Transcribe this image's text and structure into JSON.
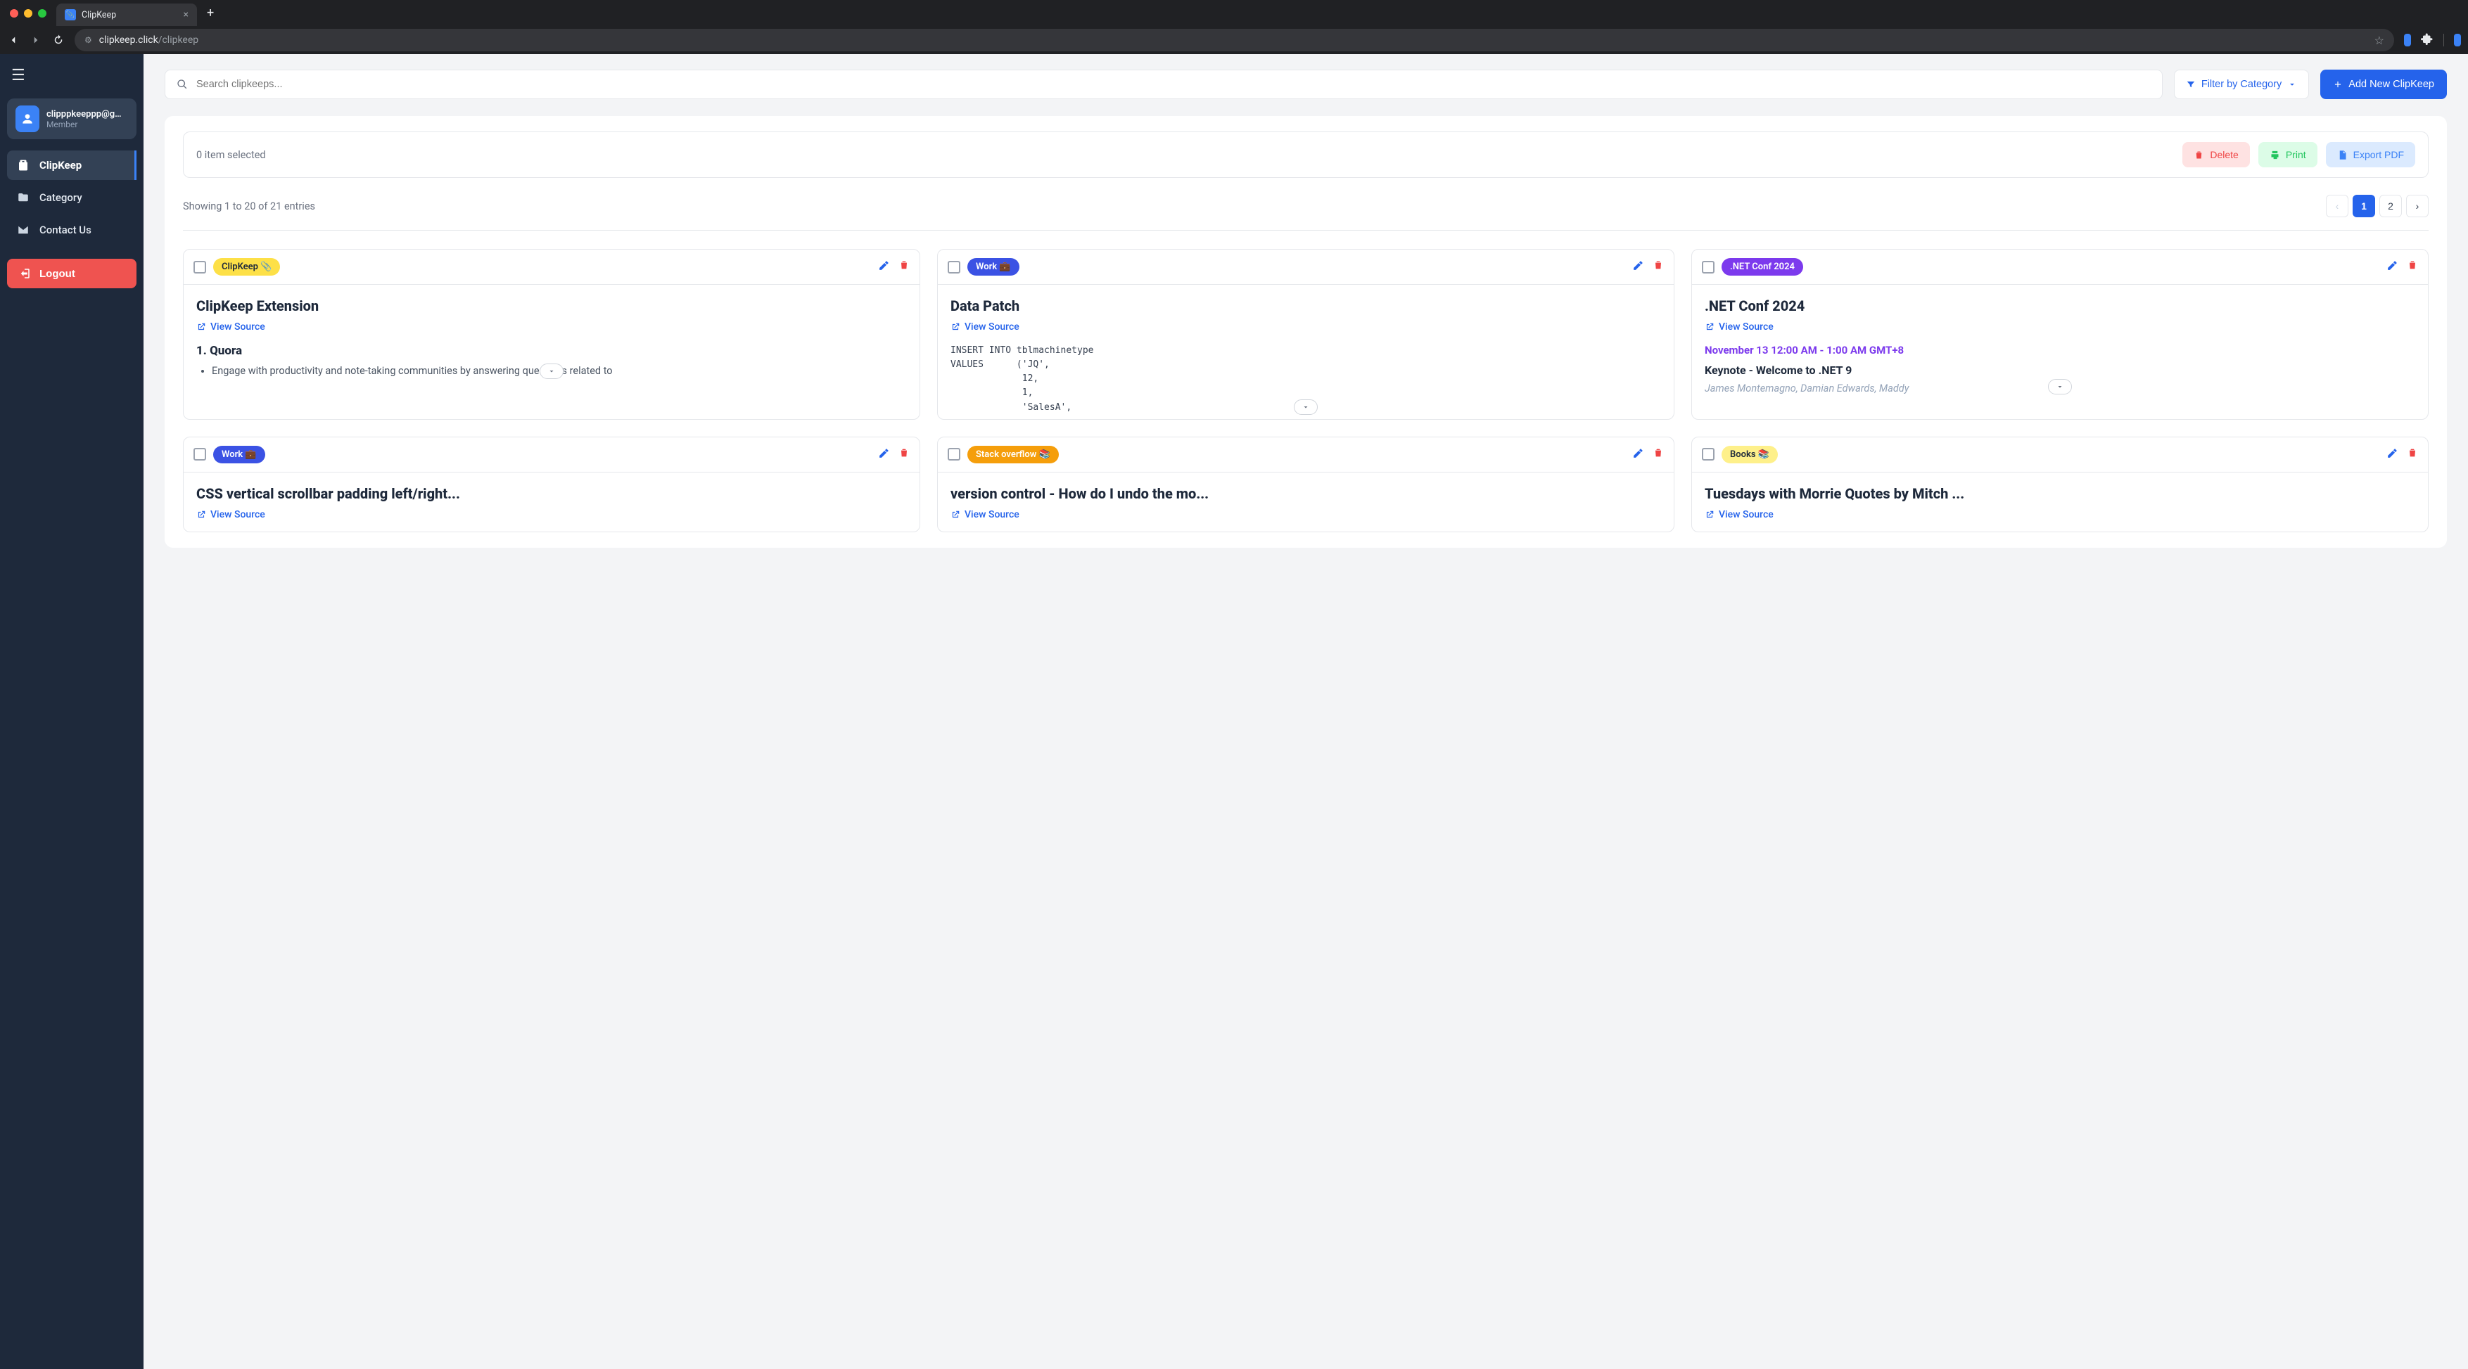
{
  "browser": {
    "tab_title": "ClipKeep",
    "url_domain": "clipkeep.click",
    "url_path": "/clipkeep"
  },
  "sidebar": {
    "user_email": "clipppkeeppp@gmai...",
    "user_role": "Member",
    "nav": [
      {
        "label": "ClipKeep"
      },
      {
        "label": "Category"
      },
      {
        "label": "Contact Us"
      }
    ],
    "logout_label": "Logout"
  },
  "toolbar": {
    "search_placeholder": "Search clipkeeps...",
    "filter_label": "Filter by Category",
    "add_label": "Add New ClipKeep"
  },
  "selection": {
    "text": "0 item selected",
    "delete_label": "Delete",
    "print_label": "Print",
    "export_label": "Export PDF"
  },
  "pager": {
    "text": "Showing 1 to 20 of 21 entries",
    "pages": [
      "1",
      "2"
    ],
    "active_index": 0
  },
  "view_source_label": "View Source",
  "cards": [
    {
      "tag_label": "ClipKeep 📎",
      "tag_class": "tag-yellow",
      "title": "ClipKeep Extension",
      "content_heading": "1. Quora",
      "content_bullet": "Engage with productivity and note-taking communities by answering questions related to",
      "has_expand": true
    },
    {
      "tag_label": "Work 💼",
      "tag_class": "tag-blue",
      "title": "Data Patch",
      "code": "INSERT INTO tblmachinetype\nVALUES      ('JQ',\n             12,\n             1,\n             'SalesA',",
      "has_expand": true
    },
    {
      "tag_label": ".NET Conf 2024",
      "tag_class": "tag-purple",
      "title": ".NET Conf 2024",
      "dotnet_time": "November 13 12:00 AM - 1:00 AM GMT+8",
      "dotnet_keynote": "Keynote - Welcome to .NET 9",
      "dotnet_speakers": "James Montemagno, Damian Edwards, Maddy",
      "has_expand": true
    },
    {
      "tag_label": "Work 💼",
      "tag_class": "tag-blue",
      "title": "CSS vertical scrollbar padding left/right...",
      "has_expand": false
    },
    {
      "tag_label": "Stack overflow 📚",
      "tag_class": "tag-orange",
      "title": "version control - How do I undo the mo...",
      "has_expand": false
    },
    {
      "tag_label": "Books 📚",
      "tag_class": "tag-lightyellow",
      "title": "Tuesdays with Morrie Quotes by Mitch ...",
      "has_expand": false
    }
  ]
}
